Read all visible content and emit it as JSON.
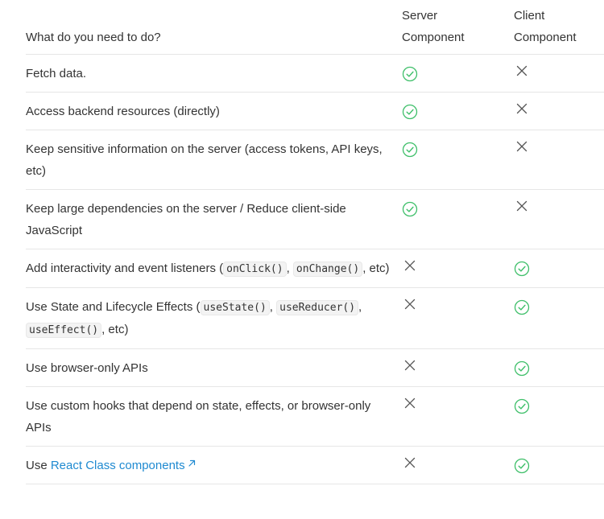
{
  "header": {
    "task": "What do you need to do?",
    "server_line1": "Server",
    "server_line2": "Component",
    "client_line1": "Client",
    "client_line2": "Component"
  },
  "rows": [
    {
      "parts": [
        {
          "t": "text",
          "v": "Fetch data."
        }
      ],
      "server": "check",
      "client": "cross"
    },
    {
      "parts": [
        {
          "t": "text",
          "v": "Access backend resources (directly)"
        }
      ],
      "server": "check",
      "client": "cross"
    },
    {
      "parts": [
        {
          "t": "text",
          "v": "Keep sensitive information on the server (access tokens, API keys, etc)"
        }
      ],
      "server": "check",
      "client": "cross"
    },
    {
      "parts": [
        {
          "t": "text",
          "v": "Keep large dependencies on the server / Reduce client-side JavaScript"
        }
      ],
      "server": "check",
      "client": "cross"
    },
    {
      "parts": [
        {
          "t": "text",
          "v": "Add interactivity and event listeners ("
        },
        {
          "t": "code",
          "v": "onClick()"
        },
        {
          "t": "text",
          "v": ", "
        },
        {
          "t": "code",
          "v": "onChange()"
        },
        {
          "t": "text",
          "v": ", etc)"
        }
      ],
      "server": "cross",
      "client": "check"
    },
    {
      "parts": [
        {
          "t": "text",
          "v": "Use State and Lifecycle Effects ("
        },
        {
          "t": "code",
          "v": "useState()"
        },
        {
          "t": "text",
          "v": ", "
        },
        {
          "t": "code",
          "v": "useReducer()"
        },
        {
          "t": "text",
          "v": ", "
        },
        {
          "t": "code",
          "v": "useEffect()"
        },
        {
          "t": "text",
          "v": ", etc)"
        }
      ],
      "server": "cross",
      "client": "check"
    },
    {
      "parts": [
        {
          "t": "text",
          "v": "Use browser-only APIs"
        }
      ],
      "server": "cross",
      "client": "check"
    },
    {
      "parts": [
        {
          "t": "text",
          "v": "Use custom hooks that depend on state, effects, or browser-only APIs"
        }
      ],
      "server": "cross",
      "client": "check"
    },
    {
      "parts": [
        {
          "t": "text",
          "v": "Use "
        },
        {
          "t": "link",
          "v": "React Class components"
        }
      ],
      "server": "cross",
      "client": "check"
    }
  ],
  "icons": {
    "check": "check-circle-icon",
    "cross": "x-icon",
    "external": "external-link-icon"
  },
  "colors": {
    "check": "#3fbf6a",
    "cross": "#555555",
    "link": "#1f8ad1",
    "rule": "#e6e6e6"
  }
}
